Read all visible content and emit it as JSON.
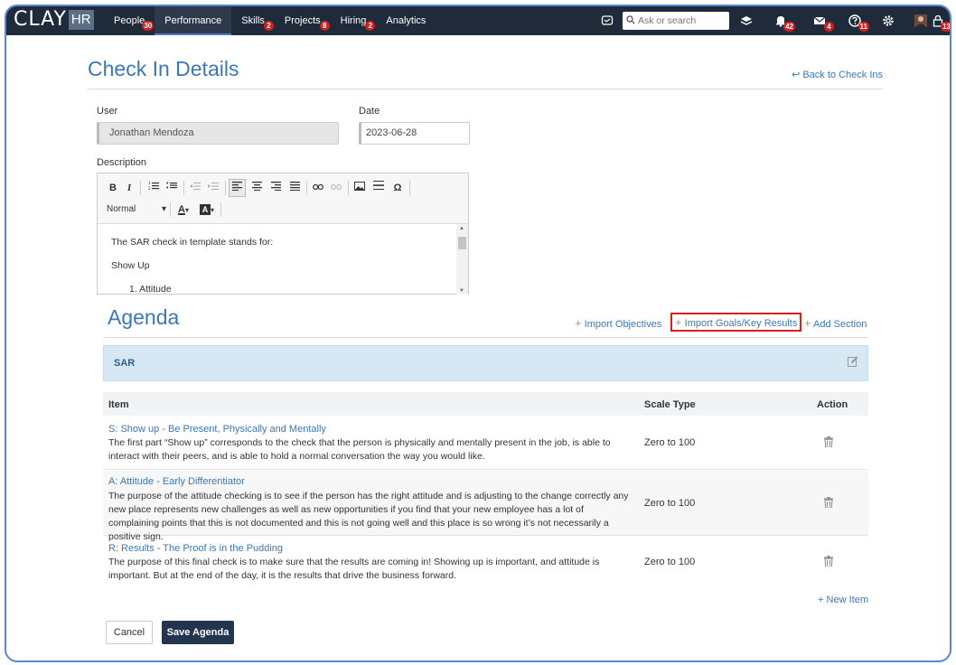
{
  "brand": {
    "logo_main": "CLAY",
    "logo_suffix": "HR"
  },
  "nav": [
    {
      "label": "People",
      "badge": "30"
    },
    {
      "label": "Performance",
      "badge": ""
    },
    {
      "label": "Skills",
      "badge": "2"
    },
    {
      "label": "Projects",
      "badge": "8"
    },
    {
      "label": "Hiring",
      "badge": "2"
    },
    {
      "label": "Analytics",
      "badge": ""
    }
  ],
  "active_nav": "Performance",
  "search": {
    "placeholder": "Ask or search"
  },
  "top_icons": {
    "bell_badge": "42",
    "mail_badge": "4",
    "help_badge": "11",
    "lock_badge": "13"
  },
  "page": {
    "title": "Check In Details",
    "back_link": "Back to Check Ins",
    "user_label": "User",
    "user_value": "Jonathan Mendoza",
    "date_label": "Date",
    "date_value": "2023-06-28",
    "description_label": "Description"
  },
  "editor": {
    "format_select": "Normal",
    "body": [
      "The SAR check in template stands for:",
      "Show Up",
      "1. Attitude"
    ]
  },
  "agenda": {
    "title": "Agenda",
    "import_objectives": "Import Objectives",
    "import_goals": "Import Goals/Key Results",
    "add_section": "Add Section",
    "section_name": "SAR",
    "columns": {
      "item": "Item",
      "scale_type": "Scale Type",
      "action": "Action"
    },
    "items": [
      {
        "title": "S: Show up - Be Present, Physically and Mentally",
        "description": "The first part “Show up” corresponds to the check that the person is physically and mentally present in the job, is able to interact with their peers, and is able to hold a normal conversation the way you would like.",
        "scale": "Zero to 100"
      },
      {
        "title": "A: Attitude - Early Differentiator",
        "description": "The purpose of the attitude checking is to see if the person has the right attitude and is adjusting to the change correctly any new place represents new challenges as well as new opportunities if you find that your new employee has a lot of complaining points that this is not documented and this is not going well and this place is so wrong  it’s not necessarily a positive sign.",
        "scale": "Zero to 100"
      },
      {
        "title": "R: Results - The Proof is in the Pudding",
        "description": "The purpose of this final check is to make sure that the results are coming in!  Showing up is important, and attitude is important.  But at the end of the day, it is the results that drive the business forward.",
        "scale": "Zero to 100"
      }
    ],
    "new_item": "New Item"
  },
  "buttons": {
    "cancel": "Cancel",
    "save": "Save Agenda"
  },
  "colors": {
    "accent": "#3b78b8",
    "topbar": "#1f2a3a",
    "highlight": "#d72020",
    "badge": "#d21f1f",
    "section": "#d5e8f4"
  }
}
